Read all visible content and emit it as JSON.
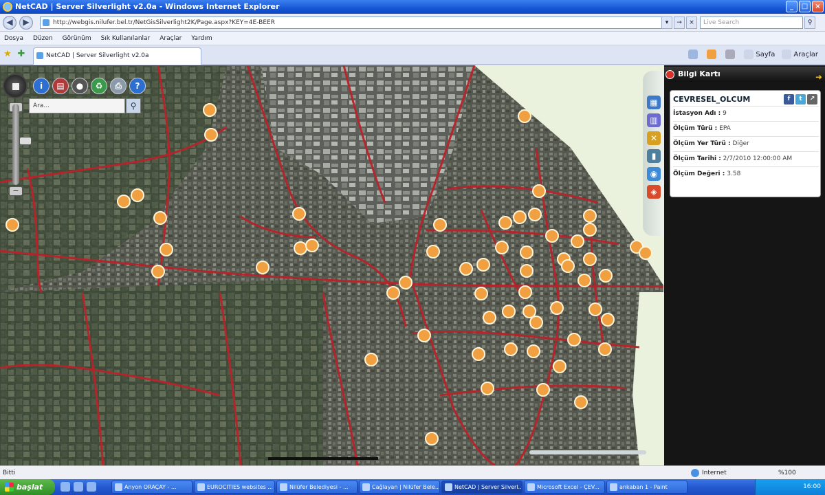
{
  "window": {
    "title": "NetCAD | Server Silverlight v2.0a - Windows Internet Explorer",
    "buttons": {
      "minimize": "_",
      "maximize": "□",
      "close": "×"
    }
  },
  "address": {
    "url": "http://webgis.nilufer.bel.tr/NetGisSilverlight2K/Page.aspx?KEY=4E-BEER",
    "search_placeholder": "Live Search",
    "nav": {
      "back": "◀",
      "forward": "▶",
      "go": "→",
      "stop": "×",
      "dropdown": "▾",
      "search_go": "⚲"
    }
  },
  "menu": [
    "Dosya",
    "Düzen",
    "Görünüm",
    "Sık Kullanılanlar",
    "Araçlar",
    "Yardım"
  ],
  "tab": {
    "label": "NetCAD | Server Silverlight v2.0a"
  },
  "commands": [
    {
      "label": ""
    },
    {
      "label": ""
    },
    {
      "label": ""
    },
    {
      "label": "Sayfa"
    },
    {
      "label": "Araçlar"
    }
  ],
  "map": {
    "search_value": "Ara...",
    "search_icon": "magnifier-icon",
    "tools": [
      {
        "icon": "info-icon",
        "glyph": "i",
        "color": "#2d6fd0"
      },
      {
        "icon": "clipboard-icon",
        "glyph": "▤",
        "color": "#b03a3a"
      },
      {
        "icon": "globe-icon",
        "glyph": "●",
        "color": "#555555"
      },
      {
        "icon": "recycle-icon",
        "glyph": "♻",
        "color": "#3a9a4a"
      },
      {
        "icon": "printer-icon",
        "glyph": "⎙",
        "color": "#8a9aa8"
      },
      {
        "icon": "help-icon",
        "glyph": "?",
        "color": "#2d6fd0"
      }
    ],
    "zoom_in": "+",
    "zoom_out": "−",
    "zoom_level": 0.55,
    "side_icons": [
      {
        "icon": "layers-icon",
        "glyph": "▦",
        "color": "#3d79c8"
      },
      {
        "icon": "buildings-icon",
        "glyph": "▥",
        "color": "#6b6bd0"
      },
      {
        "icon": "tools-icon",
        "glyph": "✕",
        "color": "#d8a020"
      },
      {
        "icon": "trash-icon",
        "glyph": "▮",
        "color": "#4f7f9e"
      },
      {
        "icon": "globe-icon",
        "glyph": "◉",
        "color": "#3d8ad8"
      },
      {
        "icon": "chart-icon",
        "glyph": "◈",
        "color": "#d84a2a"
      }
    ],
    "marker_color": "#f0a040",
    "road_color": "#b8232a"
  },
  "panel": {
    "title": "Bilgi Kartı",
    "arrows": "➜",
    "card_title": "CEVRESEL_OLCUM",
    "socials": [
      {
        "icon": "facebook-icon",
        "glyph": "f",
        "color": "#3b5998"
      },
      {
        "icon": "twitter-icon",
        "glyph": "t",
        "color": "#4aa8d8"
      },
      {
        "icon": "share-icon",
        "glyph": "↗",
        "color": "#666666"
      }
    ],
    "rows": [
      {
        "key": "İstasyon Adı :",
        "value": "9"
      },
      {
        "key": "Ölçüm Türü :",
        "value": "EPA"
      },
      {
        "key": "Ölçüm Yer Türü :",
        "value": "Diğer"
      },
      {
        "key": "Ölçüm Tarihi :",
        "value": "2/7/2010 12:00:00 AM"
      },
      {
        "key": "Ölçüm Değeri :",
        "value": "3.58"
      }
    ]
  },
  "status": {
    "left": "Bitti",
    "zone": "Internet",
    "zoom": "%100"
  },
  "taskbar": {
    "start": "başlat",
    "items": [
      {
        "label": "Anyon ORAÇAY - ..."
      },
      {
        "label": "EUROCITIES websites ..."
      },
      {
        "label": "Nilüfer Belediyesi - ..."
      },
      {
        "label": "Cağlayan | Nilüfer Bele..."
      },
      {
        "label": "NetCAD | Server Silverl..."
      },
      {
        "label": "Microsoft Excel - ÇEV..."
      },
      {
        "label": "ankaban 1 - Paint"
      }
    ],
    "active_index": 4,
    "clock": "16:00"
  }
}
